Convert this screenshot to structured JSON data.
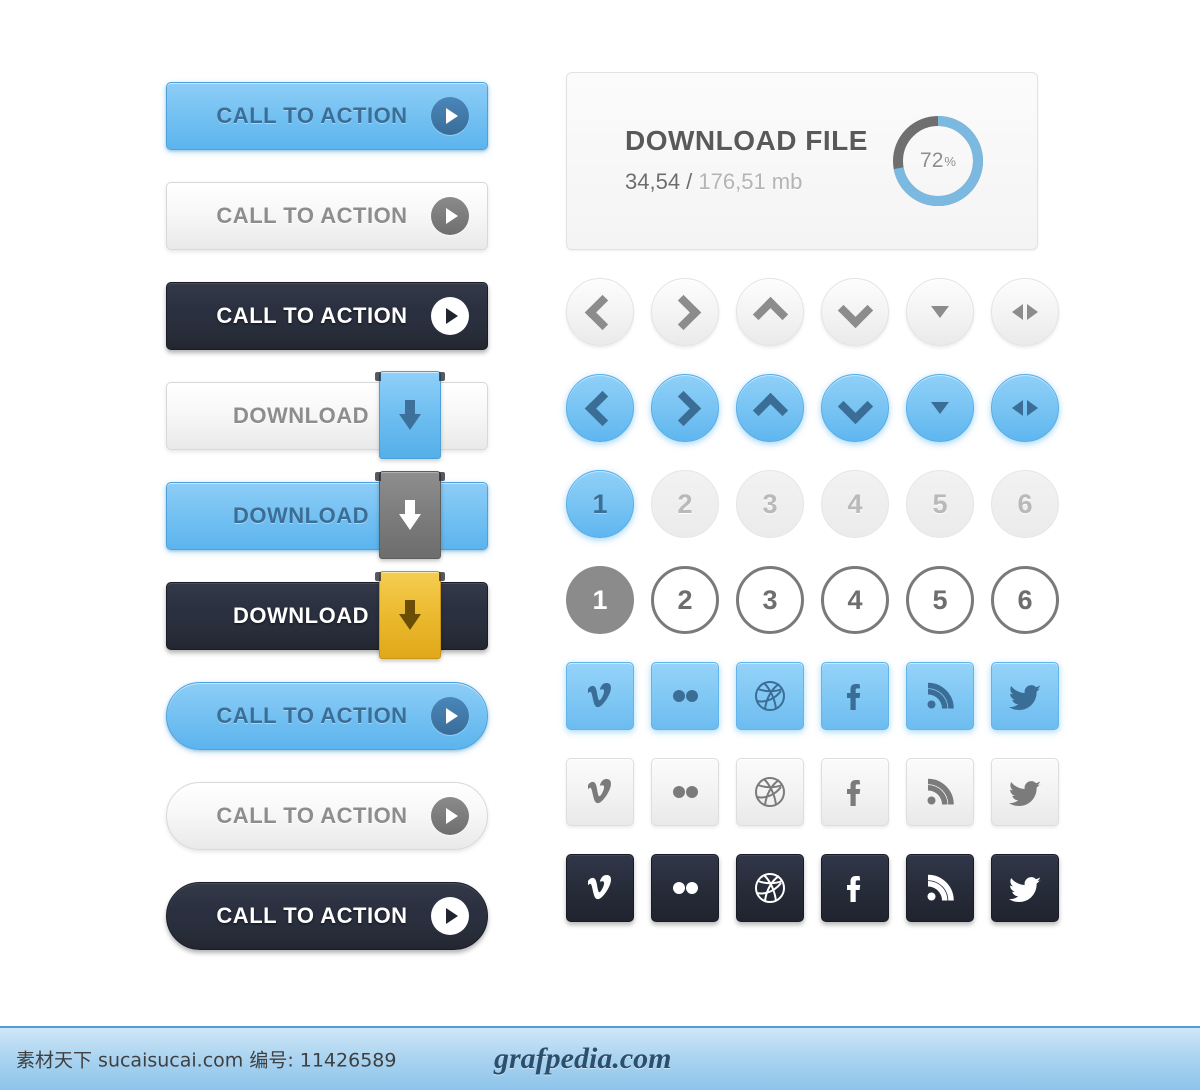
{
  "page": {
    "background": "#ffffff",
    "accent_blue": "#6dbcf0",
    "accent_dark": "#262b38",
    "accent_gold": "#eab82c",
    "accent_grey": "#8b8b8b"
  },
  "left_column": {
    "buttons": [
      {
        "id": "cta-blue",
        "label": "CALL TO ACTION",
        "style": "blue",
        "shape": "rect",
        "icon": "play-icon"
      },
      {
        "id": "cta-light",
        "label": "CALL TO ACTION",
        "style": "light",
        "shape": "rect",
        "icon": "play-icon"
      },
      {
        "id": "cta-dark",
        "label": "CALL TO ACTION",
        "style": "dark",
        "shape": "rect",
        "icon": "play-icon"
      },
      {
        "id": "dl-light",
        "label": "DOWNLOAD",
        "style": "light",
        "shape": "rect",
        "icon": "download-arrow-icon",
        "ribbon": "blue"
      },
      {
        "id": "dl-blue",
        "label": "DOWNLOAD",
        "style": "blue",
        "shape": "rect",
        "icon": "download-arrow-icon",
        "ribbon": "grey"
      },
      {
        "id": "dl-dark",
        "label": "DOWNLOAD",
        "style": "dark",
        "shape": "rect",
        "icon": "download-arrow-icon",
        "ribbon": "gold"
      },
      {
        "id": "cta-pill-blue",
        "label": "CALL TO ACTION",
        "style": "blue",
        "shape": "pill",
        "icon": "play-icon"
      },
      {
        "id": "cta-pill-light",
        "label": "CALL TO ACTION",
        "style": "light",
        "shape": "pill",
        "icon": "play-icon"
      },
      {
        "id": "cta-pill-dark",
        "label": "CALL TO ACTION",
        "style": "dark",
        "shape": "pill",
        "icon": "play-icon"
      }
    ]
  },
  "download_card": {
    "title": "DOWNLOAD FILE",
    "downloaded": "34,54",
    "separator": " / ",
    "total": "176,51 mb",
    "percent_value": "72",
    "percent_symbol": "%",
    "progress_fraction": 72,
    "ring_fill_color": "#7cb9e0",
    "ring_track_color": "#6f6f6f"
  },
  "arrow_rows": {
    "light_row": [
      {
        "id": "arrow-left",
        "icon": "chevron-left-icon"
      },
      {
        "id": "arrow-right",
        "icon": "chevron-right-icon"
      },
      {
        "id": "arrow-up",
        "icon": "chevron-up-icon"
      },
      {
        "id": "arrow-down",
        "icon": "chevron-down-icon"
      },
      {
        "id": "arrow-caret-down",
        "icon": "triangle-down-icon"
      },
      {
        "id": "arrow-left-right",
        "icon": "left-right-arrows-icon"
      }
    ],
    "blue_row": [
      {
        "id": "arrow-left",
        "icon": "chevron-left-icon"
      },
      {
        "id": "arrow-right",
        "icon": "chevron-right-icon"
      },
      {
        "id": "arrow-up",
        "icon": "chevron-up-icon"
      },
      {
        "id": "arrow-down",
        "icon": "chevron-down-icon"
      },
      {
        "id": "arrow-caret-down",
        "icon": "triangle-down-icon"
      },
      {
        "id": "arrow-left-right",
        "icon": "left-right-arrows-icon"
      }
    ]
  },
  "pagination": {
    "filled_row": {
      "active_index": 0,
      "items": [
        "1",
        "2",
        "3",
        "4",
        "5",
        "6"
      ]
    },
    "outline_row": {
      "active_index": 0,
      "items": [
        "1",
        "2",
        "3",
        "4",
        "5",
        "6"
      ]
    }
  },
  "social_rows": {
    "icons": [
      "vimeo-icon",
      "flickr-icon",
      "dribbble-icon",
      "facebook-icon",
      "rss-icon",
      "twitter-icon"
    ],
    "labels": [
      "Vimeo",
      "Flickr",
      "Dribbble",
      "Facebook",
      "RSS",
      "Twitter"
    ],
    "variants": [
      "blue",
      "light",
      "dark"
    ]
  },
  "footer": {
    "left_text": "素材天下 sucaisucai.com  编号: 11426589",
    "right_text": "grafpedia.com"
  }
}
